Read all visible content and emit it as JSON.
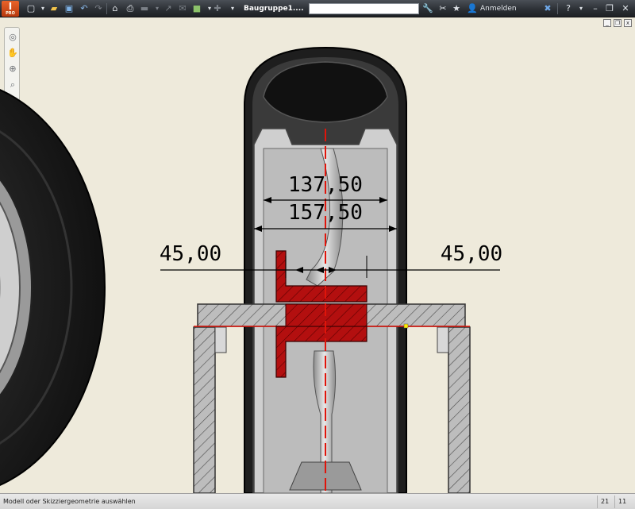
{
  "titlebar": {
    "app_logo_letter": "I",
    "app_logo_sub": "PRO",
    "document_title": "Baugruppe1....",
    "search_placeholder": "",
    "signin_label": "Anmelden",
    "icons": [
      "new-icon",
      "open-icon",
      "save-icon",
      "undo-icon",
      "redo-icon",
      "home-icon",
      "print-icon",
      "measure-icon",
      "select-icon",
      "material-icon",
      "appearance-icon",
      "zoom-dropdown-icon",
      "search-tools-icon",
      "comm-center-icon",
      "favorites-icon",
      "user-icon",
      "exchange-icon",
      "help-icon"
    ]
  },
  "navigation": {
    "tools": [
      "steering-wheel-icon",
      "pan-icon",
      "zoom-icon",
      "zoom-window-icon",
      "orbit-icon"
    ]
  },
  "drawing": {
    "dimensions": {
      "inner_width": "137,50",
      "outer_width": "157,50",
      "left_offset": "45,00",
      "right_offset": "45,00"
    },
    "colors": {
      "background": "#eeeadb",
      "tire": "#1c1c1c",
      "rim": "#bfbfbf",
      "red_part": "#b30f0f",
      "hatch": "#b2b2b2",
      "centerline": "#e0140a"
    }
  },
  "statusbar": {
    "message": "Modell oder Skizziergeometrie auswählen",
    "cell1": "21",
    "cell2": "11"
  }
}
